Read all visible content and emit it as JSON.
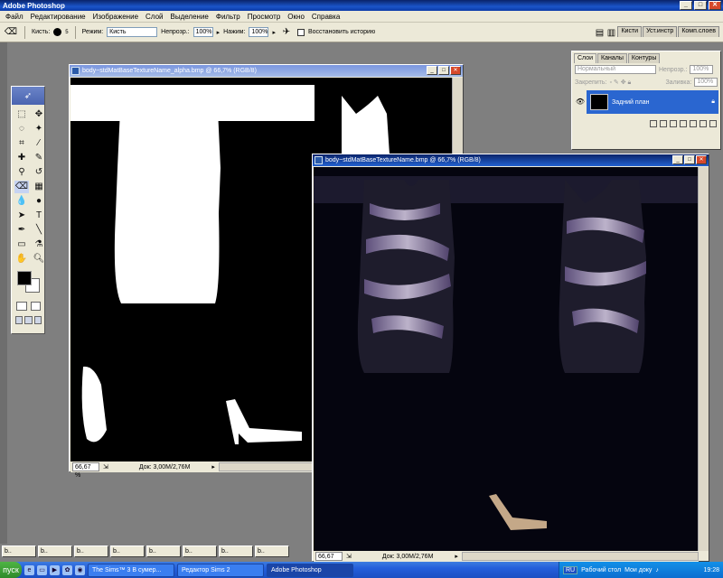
{
  "app": {
    "title": "Adobe Photoshop",
    "window_buttons": [
      "_",
      "□",
      "✕"
    ]
  },
  "menu": [
    "Файл",
    "Редактирование",
    "Изображение",
    "Слой",
    "Выделение",
    "Фильтр",
    "Просмотр",
    "Окно",
    "Справка"
  ],
  "options": {
    "brush_label": "Кисть:",
    "brush_size": "5",
    "mode_label": "Режим:",
    "mode_value": "Кисть",
    "opacity_label": "Непрозр.:",
    "opacity_value": "100%",
    "pressure_label": "Нажим:",
    "pressure_value": "100%",
    "restore_history_label": "Восстановить историю"
  },
  "palette_well": [
    "Кисти",
    "Уст.инстр",
    "Комп.слоев"
  ],
  "doc1": {
    "title": "body~stdMatBaseTextureName_alpha.bmp @ 66,7% (RGB/8)",
    "zoom": "66,67 %",
    "doc_info": "Док: 3,00M/2,76M"
  },
  "doc2": {
    "title": "body~stdMatBaseTextureName.bmp @ 66,7% (RGB/8)",
    "zoom": "66,67 %",
    "doc_info": "Док: 3,00M/2,76M"
  },
  "layers_panel": {
    "tabs": [
      "Слои",
      "Каналы",
      "Контуры"
    ],
    "blend_mode": "Нормальный",
    "opacity_label": "Непрозр.:",
    "opacity_value": "100%",
    "lock_label": "Закрепить:",
    "fill_label": "Заливка:",
    "fill_value": "100%",
    "layer_name": "Задний план"
  },
  "minimized_docs": [
    "b..",
    "b..",
    "b..",
    "b..",
    "b..",
    "b..",
    "b..",
    "b.."
  ],
  "taskbar": {
    "start_label": "пуск",
    "buttons": [
      "The Sims™ 3 В сумер...",
      "Редактор Sims 2",
      "Adobe Photoshop"
    ],
    "language": "RU",
    "desktop_label": "Рабочий стол",
    "docs_label": "Мои доку",
    "clock": "19:28"
  },
  "colors": {
    "accent": "#0a246a",
    "selected_layer": "#2a66d0"
  }
}
